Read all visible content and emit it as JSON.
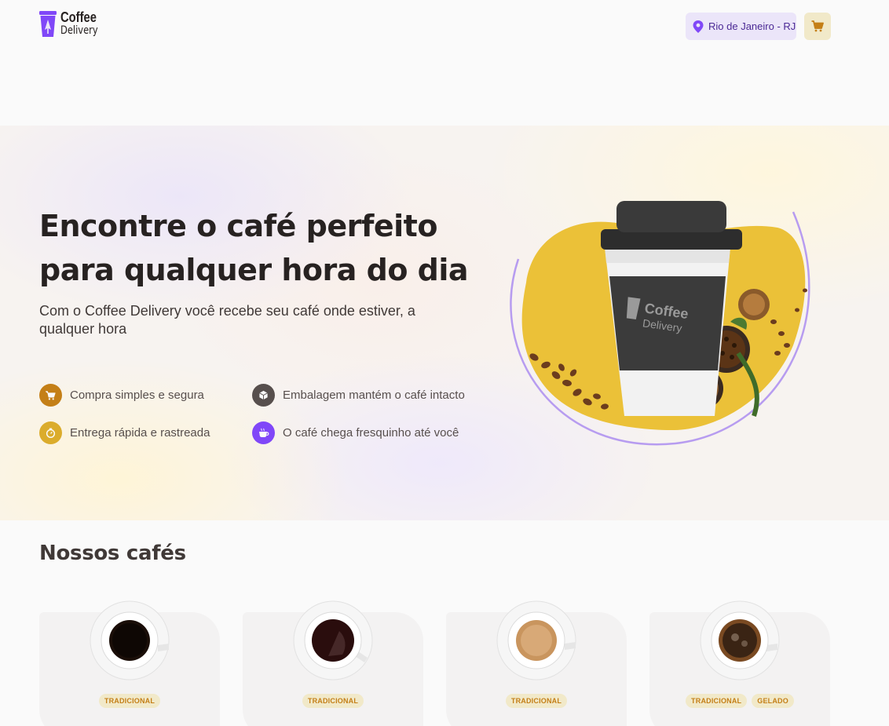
{
  "header": {
    "logo_line1": "Coffee",
    "logo_line2": "Delivery",
    "location": "Rio de Janeiro - RJ"
  },
  "hero": {
    "title_line1": "Encontre o café perfeito",
    "title_line2": "para qualquer hora do dia",
    "subtitle": "Com o Coffee Delivery você recebe seu café onde estiver, a qualquer hora",
    "features": [
      {
        "label": "Compra simples e segura",
        "icon": "cart-icon",
        "color": "#c47f17"
      },
      {
        "label": "Embalagem mantém o café intacto",
        "icon": "package-icon",
        "color": "#574f4d"
      },
      {
        "label": "Entrega rápida e rastreada",
        "icon": "timer-icon",
        "color": "#dbac2c"
      },
      {
        "label": "O café chega fresquinho até você",
        "icon": "coffee-icon",
        "color": "#8047f8"
      }
    ],
    "cup_brand_line1": "Coffee",
    "cup_brand_line2": "Delivery"
  },
  "catalog": {
    "title": "Nossos cafés",
    "cards": [
      {
        "tags": [
          "TRADICIONAL"
        ]
      },
      {
        "tags": [
          "TRADICIONAL"
        ]
      },
      {
        "tags": [
          "TRADICIONAL"
        ]
      },
      {
        "tags": [
          "TRADICIONAL",
          "GELADO"
        ]
      }
    ]
  },
  "colors": {
    "purple": "#8047f8",
    "purple_dark": "#4b2995",
    "purple_light": "#ebe5f9",
    "yellow": "#dbac2c",
    "yellow_dark": "#c47f17",
    "yellow_light": "#f1e9c9"
  }
}
